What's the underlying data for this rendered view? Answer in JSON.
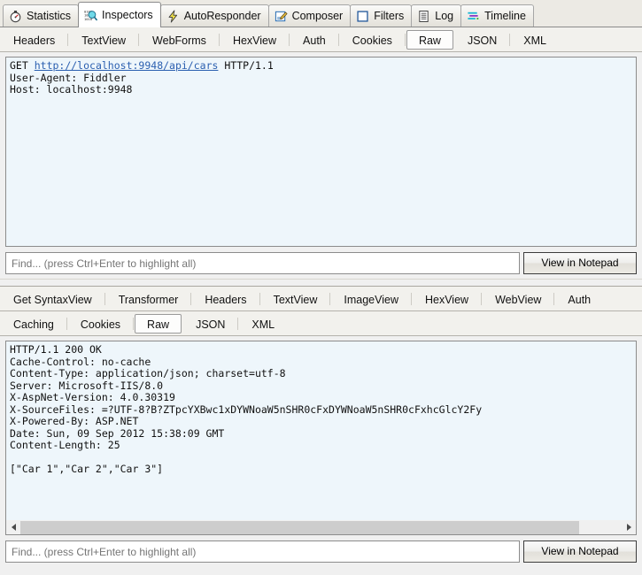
{
  "main_tabs": [
    {
      "label": "Statistics",
      "icon": "stopwatch-icon",
      "selected": false
    },
    {
      "label": "Inspectors",
      "icon": "inspectors-icon",
      "selected": true
    },
    {
      "label": "AutoResponder",
      "icon": "lightning-bolt-icon",
      "selected": false
    },
    {
      "label": "Composer",
      "icon": "compose-pencil-icon",
      "selected": false
    },
    {
      "label": "Filters",
      "icon": "filters-square-icon",
      "selected": false
    },
    {
      "label": "Log",
      "icon": "log-list-icon",
      "selected": false
    },
    {
      "label": "Timeline",
      "icon": "timeline-bars-icon",
      "selected": false
    }
  ],
  "request": {
    "tabs": [
      {
        "label": "Headers",
        "selected": false
      },
      {
        "label": "TextView",
        "selected": false
      },
      {
        "label": "WebForms",
        "selected": false
      },
      {
        "label": "HexView",
        "selected": false
      },
      {
        "label": "Auth",
        "selected": false
      },
      {
        "label": "Cookies",
        "selected": false
      },
      {
        "label": "Raw",
        "selected": true
      },
      {
        "label": "JSON",
        "selected": false
      },
      {
        "label": "XML",
        "selected": false
      }
    ],
    "raw": {
      "method": "GET",
      "url": "http://localhost:9948/api/cars",
      "version": "HTTP/1.1",
      "headers": [
        "User-Agent: Fiddler",
        "Host: localhost:9948"
      ]
    },
    "find": {
      "placeholder": "Find... (press Ctrl+Enter to highlight all)",
      "value": ""
    },
    "notepad_button": "View in Notepad"
  },
  "response": {
    "tabs_row1": [
      {
        "label": "Get SyntaxView",
        "selected": false
      },
      {
        "label": "Transformer",
        "selected": false
      },
      {
        "label": "Headers",
        "selected": false
      },
      {
        "label": "TextView",
        "selected": false
      },
      {
        "label": "ImageView",
        "selected": false
      },
      {
        "label": "HexView",
        "selected": false
      },
      {
        "label": "WebView",
        "selected": false
      },
      {
        "label": "Auth",
        "selected": false
      }
    ],
    "tabs_row2": [
      {
        "label": "Caching",
        "selected": false
      },
      {
        "label": "Cookies",
        "selected": false
      },
      {
        "label": "Raw",
        "selected": true
      },
      {
        "label": "JSON",
        "selected": false
      },
      {
        "label": "XML",
        "selected": false
      }
    ],
    "raw": "HTTP/1.1 200 OK\nCache-Control: no-cache\nContent-Type: application/json; charset=utf-8\nServer: Microsoft-IIS/8.0\nX-AspNet-Version: 4.0.30319\nX-SourceFiles: =?UTF-8?B?ZTpcYXBwc1xDYWNoaW5nSHR0cFxDYWNoaW5nSHR0cFxhcGlcY2Fy\nX-Powered-By: ASP.NET\nDate: Sun, 09 Sep 2012 15:38:09 GMT\nContent-Length: 25\n\n[\"Car 1\",\"Car 2\",\"Car 3\"]",
    "find": {
      "placeholder": "Find... (press Ctrl+Enter to highlight all)",
      "value": ""
    },
    "notepad_button": "View in Notepad",
    "scrollbar": {
      "left_arrow": "‹",
      "right_arrow": "›",
      "thumb_percent": 93
    }
  },
  "colors": {
    "text_area_background": "#eef6fb",
    "link": "#2b5fb0",
    "chrome": "#f0f0f0",
    "selected_tab": "#ffffff",
    "border": "#8c8c8c"
  }
}
